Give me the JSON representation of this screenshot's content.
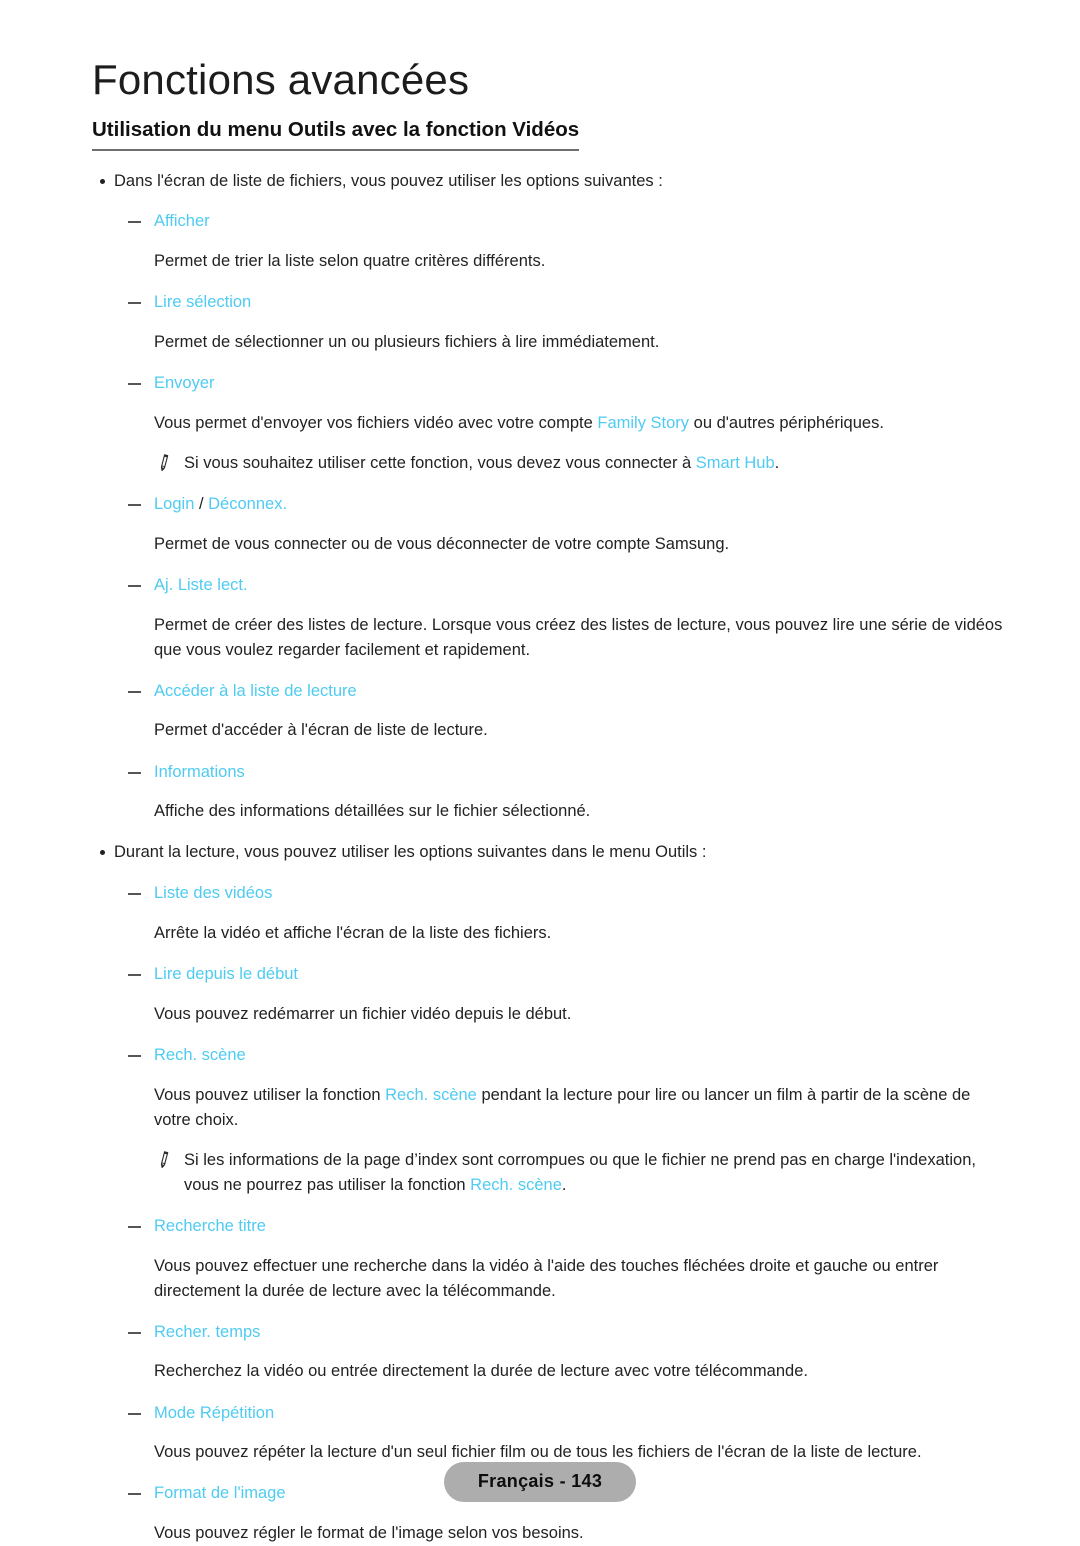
{
  "header": {
    "chapter_title": "Fonctions avancées",
    "section_title": "Utilisation du menu Outils avec la fonction Vidéos"
  },
  "intro_bullet_1": "Dans l'écran de liste de fichiers, vous pouvez utiliser les options suivantes :",
  "intro_bullet_2": "Durant la lecture, vous pouvez utiliser les options suivantes dans le menu Outils :",
  "group1": [
    {
      "label": "Afficher",
      "desc": "Permet de trier la liste selon quatre critères différents."
    },
    {
      "label": "Lire sélection",
      "desc": "Permet de sélectionner un ou plusieurs fichiers à lire immédiatement."
    },
    {
      "label": "Envoyer",
      "desc_pre": "Vous permet d'envoyer vos fichiers vidéo avec votre compte ",
      "desc_link": "Family Story",
      "desc_post": " ou d'autres périphériques.",
      "note_pre": "Si vous souhaitez utiliser cette fonction, vous devez vous connecter à ",
      "note_link": "Smart Hub",
      "note_post": "."
    },
    {
      "label": "Login",
      "label_sep": " / ",
      "label2": "Déconnex.",
      "desc": "Permet de vous connecter ou de vous déconnecter de votre compte Samsung."
    },
    {
      "label": "Aj. Liste lect.",
      "desc": "Permet de créer des listes de lecture. Lorsque vous créez des listes de lecture, vous pouvez lire une série de vidéos que vous voulez regarder facilement et rapidement."
    },
    {
      "label": "Accéder à la liste de lecture",
      "desc": "Permet d'accéder à l'écran de liste de lecture."
    },
    {
      "label": "Informations",
      "desc": "Affiche des informations détaillées sur le fichier sélectionné."
    }
  ],
  "group2": [
    {
      "label": "Liste des vidéos",
      "desc": "Arrête la vidéo et affiche l'écran de la liste des fichiers."
    },
    {
      "label": "Lire depuis le début",
      "desc": "Vous pouvez redémarrer un fichier vidéo depuis le début."
    },
    {
      "label": "Rech. scène",
      "desc_pre": "Vous pouvez utiliser la fonction ",
      "desc_link": "Rech. scène",
      "desc_post": " pendant la lecture pour lire ou lancer un film à partir de la scène de votre choix.",
      "note_pre": "Si les informations de la page d’index sont corrompues ou que le fichier ne prend pas en charge l'indexation, vous ne pourrez pas utiliser la fonction ",
      "note_link": "Rech. scène",
      "note_post": "."
    },
    {
      "label": "Recherche titre",
      "desc": "Vous pouvez effectuer une recherche dans la vidéo à l'aide des touches fléchées droite et gauche ou entrer directement la durée de lecture avec la télécommande."
    },
    {
      "label": "Recher. temps",
      "desc": "Recherchez la vidéo ou entrée directement la durée de lecture avec votre télécommande."
    },
    {
      "label": "Mode Répétition",
      "desc": "Vous pouvez répéter la lecture d'un seul fichier film ou de tous les fichiers de l'écran de la liste de lecture."
    },
    {
      "label": "Format de l'image",
      "desc": "Vous pouvez régler le format de l'image selon vos besoins."
    }
  ],
  "footer": {
    "page_label": "Français - 143"
  },
  "colors": {
    "accent": "#4FCBF2",
    "text": "#222222",
    "pill_background": "#ADADAD"
  }
}
